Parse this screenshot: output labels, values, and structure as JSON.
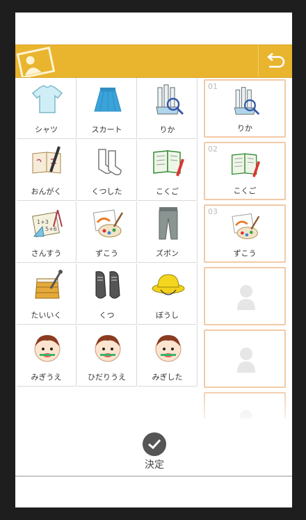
{
  "grid": {
    "items": [
      {
        "label": "シャツ",
        "icon": "shirt-icon"
      },
      {
        "label": "スカート",
        "icon": "skirt-icon"
      },
      {
        "label": "りか",
        "icon": "science-flask-icon"
      },
      {
        "label": "おんがく",
        "icon": "music-recorder-icon"
      },
      {
        "label": "くつした",
        "icon": "socks-icon"
      },
      {
        "label": "こくご",
        "icon": "japanese-book-pencil-icon"
      },
      {
        "label": "さんすう",
        "icon": "math-notebook-icon"
      },
      {
        "label": "ずこう",
        "icon": "art-palette-icon"
      },
      {
        "label": "ズボン",
        "icon": "pants-icon"
      },
      {
        "label": "たいいく",
        "icon": "vaulting-box-icon"
      },
      {
        "label": "くつ",
        "icon": "shoes-icon"
      },
      {
        "label": "ぼうし",
        "icon": "yellow-hat-icon"
      },
      {
        "label": "みぎうえ",
        "icon": "brushing-teeth-icon"
      },
      {
        "label": "ひだりうえ",
        "icon": "brushing-teeth-icon"
      },
      {
        "label": "みぎした",
        "icon": "brushing-teeth-icon"
      }
    ]
  },
  "schedule": {
    "slots": [
      {
        "number": "01",
        "label": "りか",
        "icon": "science-flask-icon"
      },
      {
        "number": "02",
        "label": "こくご",
        "icon": "japanese-book-pencil-icon"
      },
      {
        "number": "03",
        "label": "ずこう",
        "icon": "art-palette-icon"
      },
      {
        "number": "",
        "label": "",
        "icon": "person-placeholder-icon"
      },
      {
        "number": "",
        "label": "",
        "icon": "person-placeholder-icon"
      },
      {
        "number": "",
        "label": "",
        "icon": "person-placeholder-icon"
      }
    ]
  },
  "footer": {
    "decide_label": "決定"
  },
  "colors": {
    "header": "#e9b52f",
    "slot_border": "#f2c9a6",
    "frame": "#1e1e1e"
  }
}
